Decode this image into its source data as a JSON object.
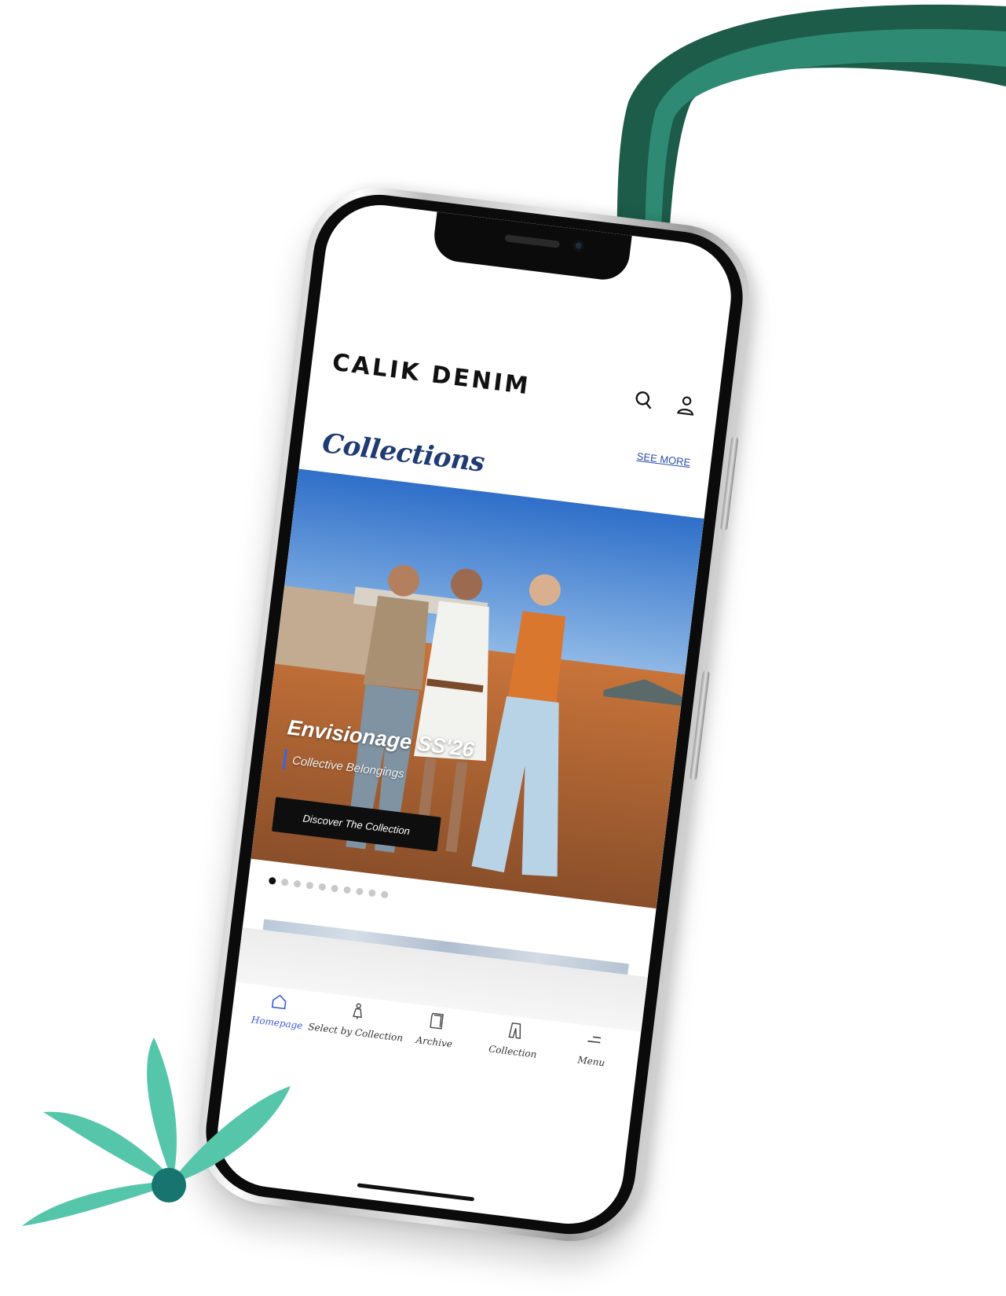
{
  "app": {
    "brand": "CALIK DENIM"
  },
  "header": {
    "search_icon": "search-icon",
    "profile_icon": "user-icon"
  },
  "collections": {
    "title": "Collections",
    "see_more": "SEE MORE",
    "hero": {
      "title": "Envisionage SS'26",
      "subtitle": "Collective Belongings",
      "button_label": "Discover The Collection"
    },
    "carousel": {
      "total_slides": 10,
      "active_index": 0
    }
  },
  "tabbar": {
    "items": [
      {
        "label": "Homepage",
        "icon": "home-icon",
        "active": true
      },
      {
        "label": "Select by Collection",
        "icon": "dress-icon",
        "active": false
      },
      {
        "label": "Archive",
        "icon": "archive-icon",
        "active": false
      },
      {
        "label": "Collection",
        "icon": "jeans-icon",
        "active": false
      },
      {
        "label": "Menu",
        "icon": "menu-icon",
        "active": false
      }
    ]
  },
  "colors": {
    "title_blue": "#1f3b73",
    "link_blue": "#2c4fae",
    "active_tab": "#3f5bd9",
    "ribbon_dark": "#1d5c49",
    "ribbon_light": "#2f8a73",
    "leaf_green": "#56c6aa",
    "leaf_center": "#17746e"
  }
}
